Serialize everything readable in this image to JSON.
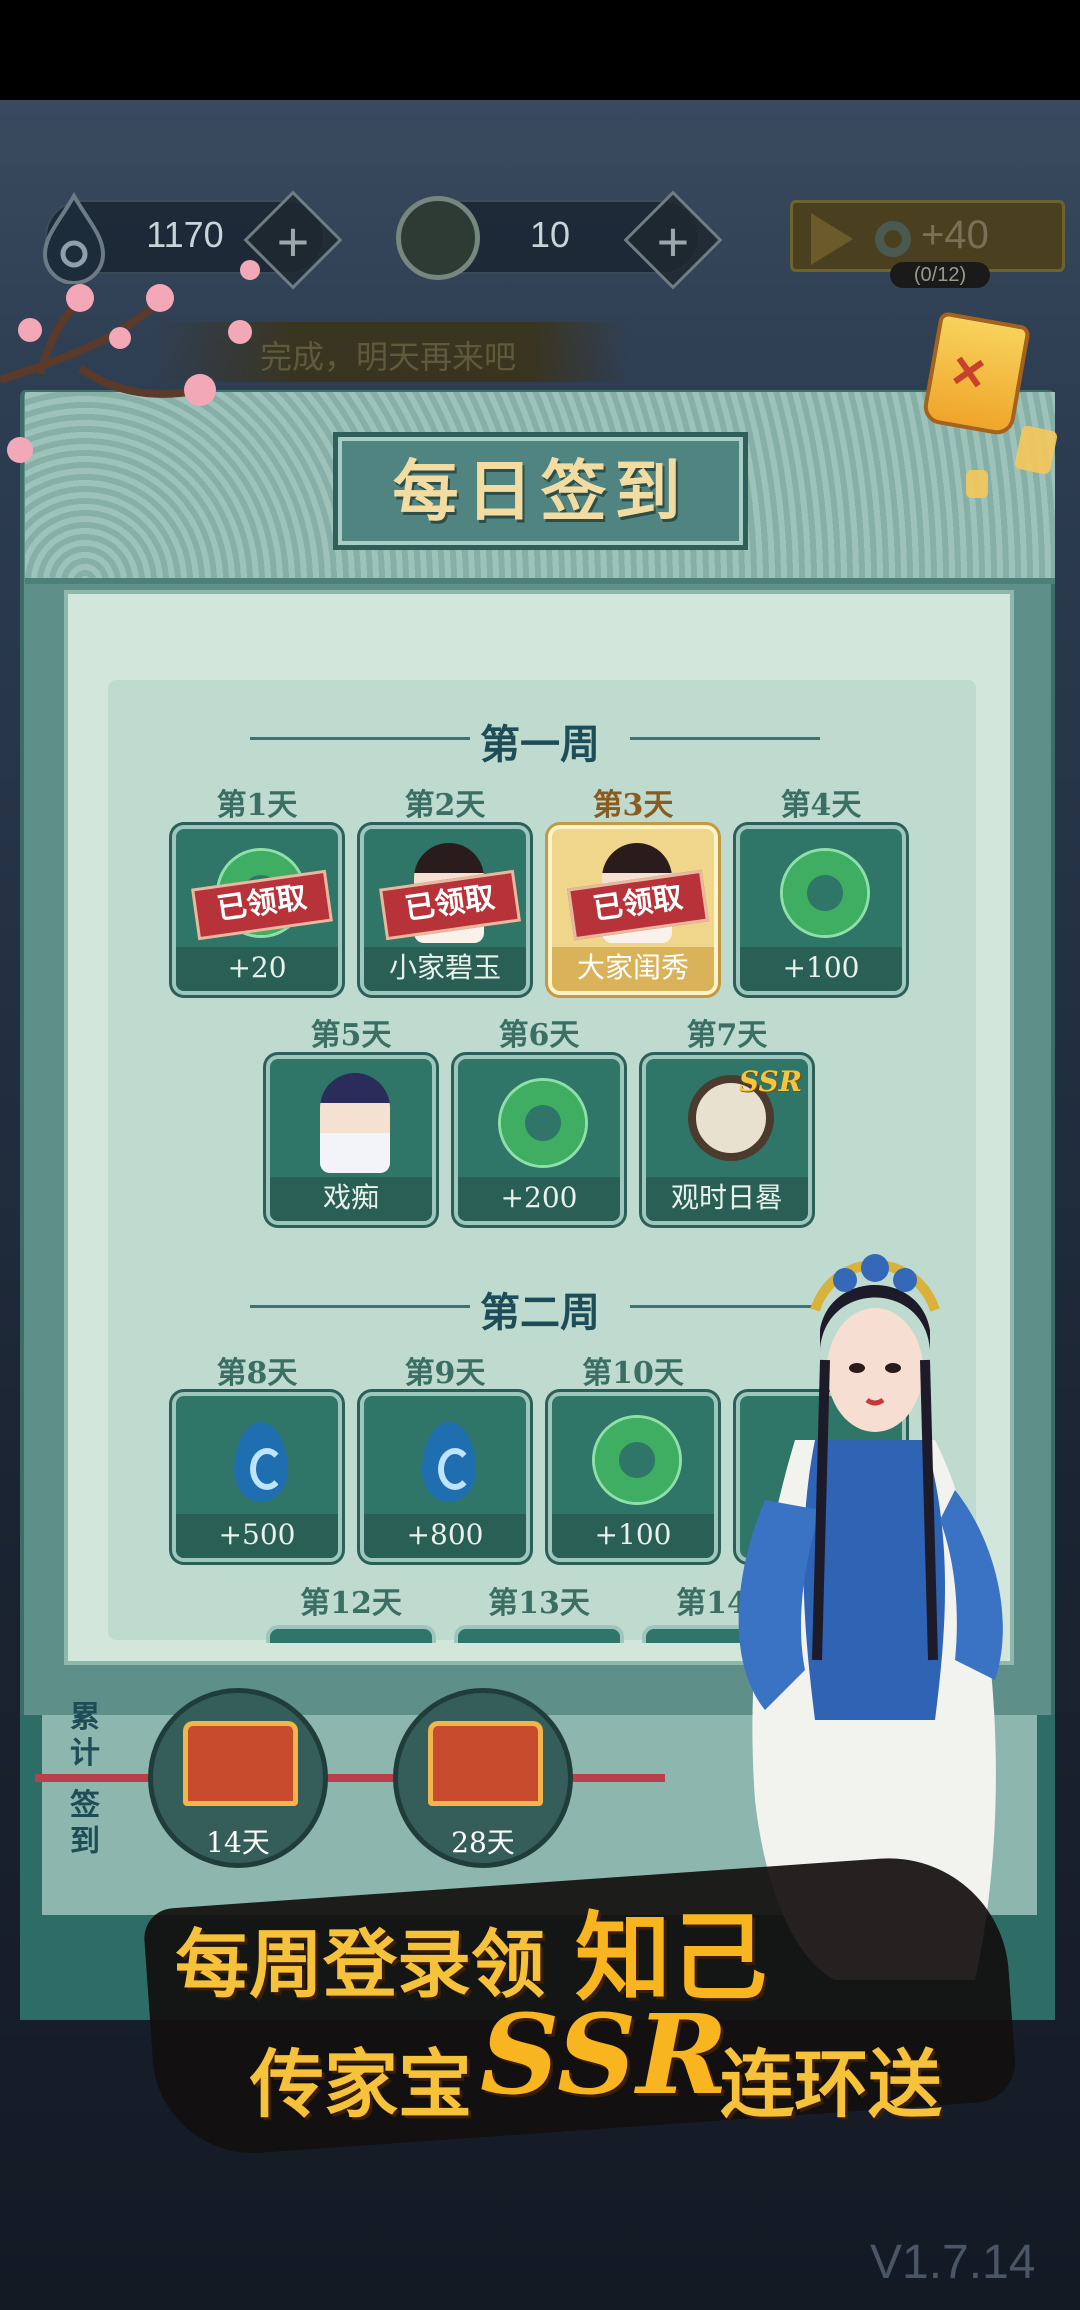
{
  "resources": {
    "currency1": {
      "value": "1170",
      "icon": "water-drop-icon"
    },
    "currency2": {
      "value": "10",
      "icon": "jade-coin-icon"
    },
    "video_bonus": {
      "value": "+40",
      "progress": "(0/12)",
      "icon": "play-icon"
    }
  },
  "notice": "完成，明天再来吧",
  "panel": {
    "title": "每日签到",
    "close_icon": "lantern-close-icon"
  },
  "weeks": [
    {
      "title": "第一周",
      "days": [
        {
          "label": "第1天",
          "reward": "+20",
          "icon": "jade-ring-icon",
          "claimed": "已领取"
        },
        {
          "label": "第2天",
          "reward": "小家碧玉",
          "icon": "portrait-icon",
          "claimed": "已领取"
        },
        {
          "label": "第3天",
          "reward": "大家闺秀",
          "icon": "portrait-icon",
          "claimed": "已领取",
          "highlight": true
        },
        {
          "label": "第4天",
          "reward": "+100",
          "icon": "jade-ring-icon"
        },
        {
          "label": "第5天",
          "reward": "戏痴",
          "icon": "opera-portrait-icon"
        },
        {
          "label": "第6天",
          "reward": "+200",
          "icon": "jade-ring-icon"
        },
        {
          "label": "第7天",
          "reward": "观时日晷",
          "icon": "sundial-icon",
          "badge": "SSR"
        }
      ]
    },
    {
      "title": "第二周",
      "days": [
        {
          "label": "第8天",
          "reward": "+500",
          "icon": "water-drop-icon"
        },
        {
          "label": "第9天",
          "reward": "+800",
          "icon": "water-drop-icon"
        },
        {
          "label": "第10天",
          "reward": "+100",
          "icon": "jade-ring-icon"
        },
        {
          "label": "第12天"
        },
        {
          "label": "第13天"
        },
        {
          "label": "第14天"
        }
      ]
    }
  ],
  "cumulative": {
    "label_top": "累计",
    "label_bottom": "签到",
    "chests": [
      {
        "days": "14天",
        "icon": "treasure-chest-icon"
      },
      {
        "days": "28天",
        "icon": "treasure-chest-icon"
      }
    ]
  },
  "banner": {
    "line1_a": "每周登录领",
    "line1_b": "知己",
    "line2_a": "传家宝",
    "line2_b": "SSR",
    "line2_c": "连环送"
  },
  "version": "V1.7.14",
  "colors": {
    "panel_teal": "#5e8f88",
    "card_teal": "#2f7668",
    "gold_text": "#f6c23a",
    "stamp_red": "#b8323a"
  }
}
